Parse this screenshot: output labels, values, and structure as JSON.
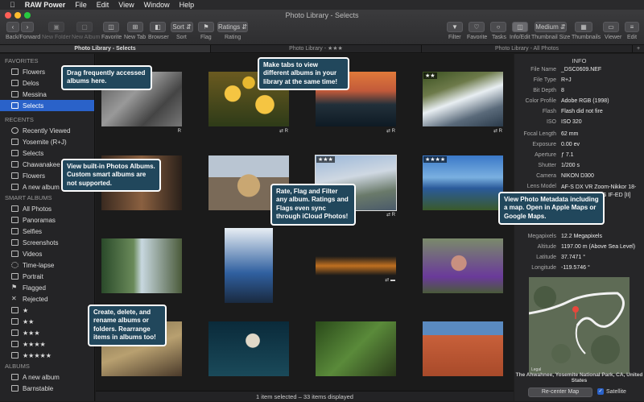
{
  "menubar": {
    "apple": "",
    "app_name": "RAW Power",
    "items": [
      "File",
      "Edit",
      "View",
      "Window",
      "Help"
    ]
  },
  "window": {
    "title": "Photo Library - Selects"
  },
  "toolbar": {
    "back_forward_label": "Back/Forward",
    "new_folder_label": "New Folder",
    "new_album_label": "New Album",
    "favorite_label": "Favorite",
    "new_tab_label": "New Tab",
    "browser_label": "Browser",
    "sort_button": "Sort",
    "sort_label": "Sort",
    "flag_label": "Flag",
    "ratings_button": "Ratings",
    "ratings_label": "Rating",
    "filter_label": "Filter",
    "favorite2_label": "Favorite",
    "tasks_label": "Tasks",
    "infoedit_label": "Info/Edit",
    "thumb_size_value": "Medium",
    "thumb_size_label": "Thumbnail Size",
    "thumbnails_label": "Thumbnails",
    "viewer_label": "Viewer",
    "edit_label": "Edit"
  },
  "tabs": [
    "Photo Library - Selects",
    "Photo Library - ★★★",
    "Photo Library - All Photos"
  ],
  "tab_add": "+",
  "sidebar": {
    "favorites_header": "FAVORITES",
    "favorites": [
      "Flowers",
      "Delos",
      "Messina",
      "Selects"
    ],
    "recents_header": "RECENTS",
    "recents": [
      "Recently Viewed",
      "Yosemite (R+J)",
      "Selects",
      "Chawanakee",
      "Flowers",
      "A new album"
    ],
    "smart_header": "SMART ALBUMS",
    "smart": [
      "All Photos",
      "Panoramas",
      "Selfies",
      "Screenshots",
      "Videos",
      "Time-lapse",
      "Portrait",
      "Flagged",
      "Rejected",
      "★",
      "★★",
      "★★★",
      "★★★★",
      "★★★★★"
    ],
    "albums_header": "ALBUMS",
    "albums": [
      "A new album",
      "Barnstable"
    ]
  },
  "grid": {
    "badges": [
      "R",
      "⇄ R",
      "⇄ R",
      "⇄ R",
      "⇄ R",
      "⇄ ▬",
      "R",
      "R"
    ],
    "star_labels": [
      "★★",
      "★★★",
      "★★★★"
    ]
  },
  "status": "1 item selected – 33 items displayed",
  "info": {
    "title": "INFO",
    "rows": [
      {
        "k": "File Name",
        "v": "_DSC0609.NEF"
      },
      {
        "k": "File Type",
        "v": "R+J"
      },
      {
        "k": "Bit Depth",
        "v": "8"
      },
      {
        "k": "Color Profile",
        "v": "Adobe RGB (1998)"
      },
      {
        "k": "Flash",
        "v": "Flash did not fire"
      },
      {
        "k": "ISO",
        "v": "ISO 320"
      },
      {
        "k": "Focal Length",
        "v": "62 mm"
      },
      {
        "k": "Exposure",
        "v": "0.00 ev"
      },
      {
        "k": "Aperture",
        "v": "ƒ 7.1"
      },
      {
        "k": "Shutter",
        "v": "1/200 s"
      },
      {
        "k": "Camera",
        "v": "NIKON D300"
      },
      {
        "k": "Lens Model",
        "v": "AF-S DX VR Zoom-Nikkor 18-200mm f/3.5-5.6G IF-ED [II]"
      },
      {
        "k": "Megapixels",
        "v": "12.2 Megapixels"
      },
      {
        "k": "Altitude",
        "v": "1197.00 m (Above Sea Level)"
      },
      {
        "k": "Latitude",
        "v": "37.7471 °"
      },
      {
        "k": "Longitude",
        "v": "-119.5746 °"
      }
    ],
    "map_caption": "The Ahwahnee, Yosemite National Park, CA, United States",
    "map_legal": "Legal",
    "recenter": "Re-center Map",
    "satellite": "Satellite"
  },
  "callouts": [
    "Drag frequently accessed albums here.",
    "Make tabs to view different albums in your library at the same time!",
    "View built-in Photos Albums. Custom smart albums are not supported.",
    "Rate, Flag and Filter any album. Ratings and Flags even sync through iCloud Photos!",
    "View Photo Metadata including a map. Open in Apple Maps or Google Maps.",
    "Create, delete, and rename albums or folders. Rearrange items in albums too!"
  ],
  "colors": {
    "accent": "#2a62c9",
    "callout_bg": "#21475c"
  }
}
